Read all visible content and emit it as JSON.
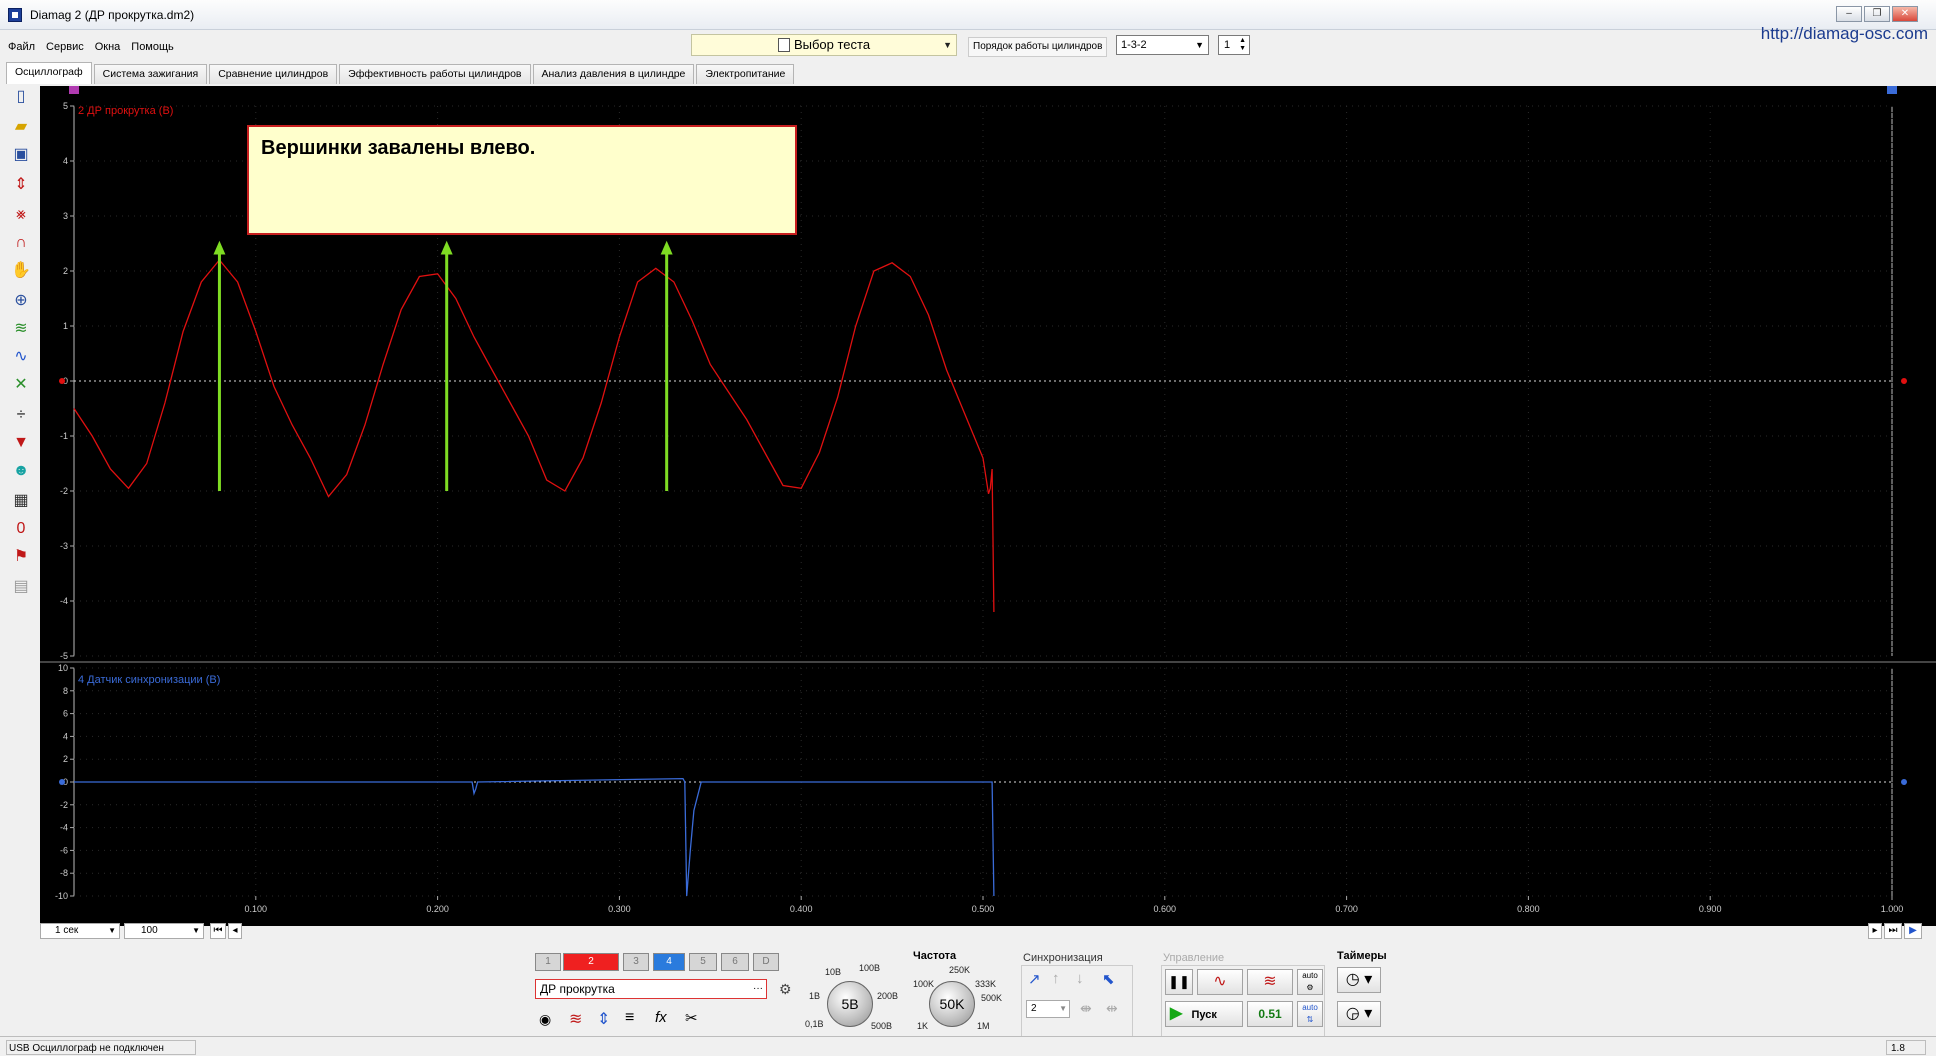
{
  "window": {
    "title": "Diamag 2 (ДР прокрутка.dm2)",
    "site_url": "http://diamag-osc.com",
    "btn_minimize": "–",
    "btn_restore": "❐",
    "btn_close": "✕"
  },
  "menu": [
    "Файл",
    "Сервис",
    "Окна",
    "Помощь"
  ],
  "toolbar_top": {
    "test_select": "Выбор теста",
    "fire_order_label": "Порядок работы цилиндров",
    "fire_order_value": "1-3-2",
    "cylinder_value": "1"
  },
  "tabs": [
    "Осциллограф",
    "Система зажигания",
    "Сравнение цилиндров",
    "Эффективность работы цилиндров",
    "Анализ давления в цилиндре",
    "Электропитание"
  ],
  "left_tools": [
    "new-file-icon",
    "open-file-icon",
    "save-icon",
    "auto-scale-icon",
    "cursor-measure-icon",
    "arc-measure-icon",
    "hand-pan-icon",
    "zoom-icon",
    "channel-overlay-icon",
    "channel-wave-icon",
    "channel-invert-icon",
    "divider-icon",
    "filter-icon",
    "math-channel-icon",
    "grid-icon",
    "zero-level-icon",
    "marker-add-icon",
    "notes-icon"
  ],
  "chart_data": {
    "type": "line",
    "xlim": [
      0.0,
      1.0
    ],
    "x_ticks": [
      "0.100",
      "0.200",
      "0.300",
      "0.400",
      "0.500",
      "0.600",
      "0.700",
      "0.800",
      "0.900",
      "1.000"
    ],
    "panels": [
      {
        "label": "2 ДР прокрутка (В)",
        "color": "#e01010",
        "ylim": [
          -5,
          5
        ],
        "y_ticks": [
          5,
          4,
          3,
          2,
          1,
          0,
          -1,
          -2,
          -3,
          -4,
          -5
        ],
        "series": [
          {
            "name": "2 ДР прокрутка (В)",
            "x": [
              0.0,
              0.01,
              0.02,
              0.03,
              0.04,
              0.05,
              0.06,
              0.07,
              0.08,
              0.09,
              0.1,
              0.11,
              0.12,
              0.13,
              0.14,
              0.15,
              0.16,
              0.17,
              0.18,
              0.19,
              0.2,
              0.21,
              0.22,
              0.23,
              0.24,
              0.25,
              0.26,
              0.27,
              0.28,
              0.29,
              0.3,
              0.31,
              0.32,
              0.33,
              0.34,
              0.35,
              0.36,
              0.37,
              0.38,
              0.39,
              0.4,
              0.41,
              0.42,
              0.43,
              0.44,
              0.45,
              0.46,
              0.47,
              0.48,
              0.49,
              0.5,
              0.503,
              0.504,
              0.505,
              0.506
            ],
            "y": [
              -0.5,
              -1.0,
              -1.6,
              -1.95,
              -1.5,
              -0.4,
              0.9,
              1.8,
              2.2,
              1.8,
              0.9,
              -0.1,
              -0.8,
              -1.4,
              -2.1,
              -1.7,
              -0.8,
              0.3,
              1.3,
              1.9,
              1.95,
              1.5,
              0.8,
              0.2,
              -0.4,
              -1.0,
              -1.8,
              -2.0,
              -1.4,
              -0.4,
              0.8,
              1.8,
              2.05,
              1.8,
              1.1,
              0.3,
              -0.2,
              -0.7,
              -1.3,
              -1.9,
              -1.95,
              -1.3,
              -0.3,
              1.0,
              2.0,
              2.15,
              1.9,
              1.2,
              0.2,
              -0.6,
              -1.4,
              -2.05,
              -1.95,
              -1.6,
              -4.2
            ]
          }
        ],
        "annotation_arrows_x": [
          0.08,
          0.205,
          0.326
        ]
      },
      {
        "label": "4 Датчик синхронизации (В)",
        "color": "#3a6bd8",
        "ylim": [
          -10,
          10
        ],
        "y_ticks": [
          10,
          8,
          6,
          4,
          2,
          0,
          -2,
          -4,
          -6,
          -8,
          -10
        ],
        "series": [
          {
            "name": "4 Датчик синхронизации (В)",
            "x": [
              0.0,
              0.219,
              0.22,
              0.221,
              0.222,
              0.335,
              0.336,
              0.337,
              0.339,
              0.341,
              0.345,
              0.5,
              0.505,
              0.506
            ],
            "y": [
              0,
              0,
              -1.0,
              -0.6,
              0,
              0.3,
              0,
              -10,
              -6,
              -2.5,
              0,
              0,
              0,
              -10
            ]
          }
        ]
      }
    ]
  },
  "annotation": {
    "text": "Вершинки завалены влево."
  },
  "timebase": {
    "time_per_div": "1 сек",
    "zoom_value": "100"
  },
  "control_panel": {
    "channels": [
      "1",
      "2",
      "3",
      "4",
      "5",
      "6",
      "D"
    ],
    "sensor_name": "ДР прокрутка",
    "voltage_knob_value": "5В",
    "voltage_ticks": [
      "10В",
      "100В",
      "1В",
      "200В",
      "0,1В",
      "500В"
    ],
    "frequency_title": "Частота",
    "frequency_knob_value": "50K",
    "frequency_ticks": [
      "250K",
      "100K",
      "333K",
      "500K",
      "1K",
      "1M"
    ],
    "sync_title": "Синхронизация",
    "sync_channel": "2",
    "control_title": "Управление",
    "run_button": "Пуск",
    "rate_value": "0.51",
    "auto_label": "auto",
    "timers_title": "Таймеры"
  },
  "status": {
    "left": "USB Осциллограф не подключен",
    "right": "1.8"
  }
}
